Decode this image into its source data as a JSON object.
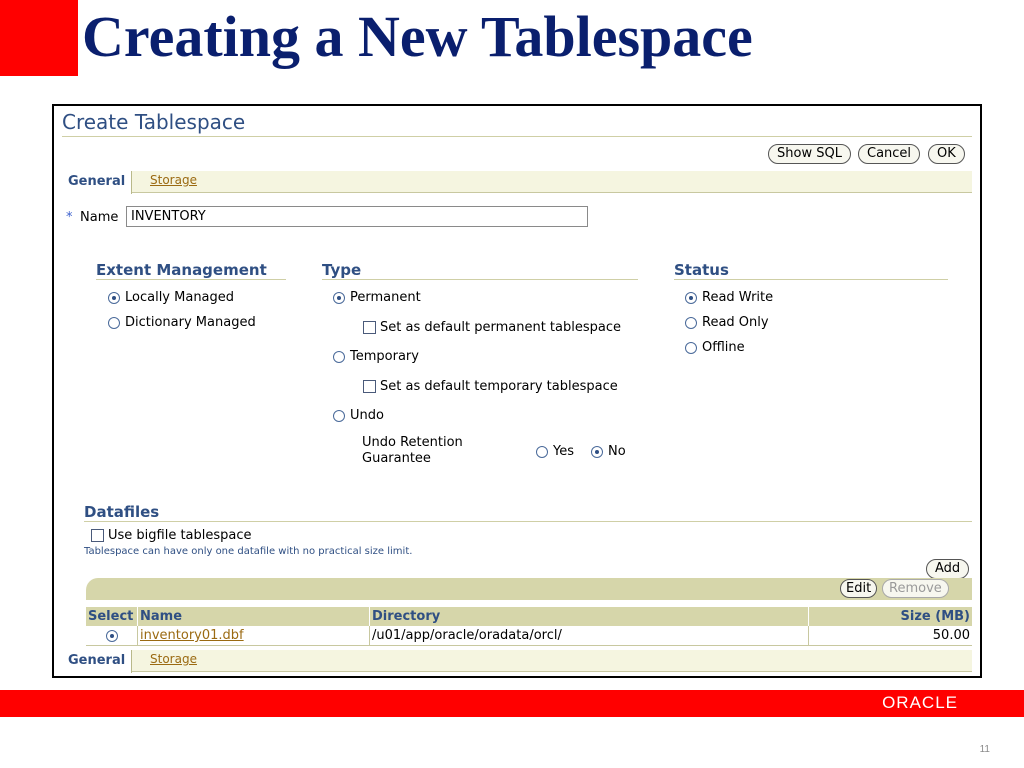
{
  "slide": {
    "title": "Creating a New Tablespace",
    "logo": "ORACLE",
    "page_number": "11"
  },
  "page_heading": "Create Tablespace",
  "buttons": {
    "show_sql": "Show SQL",
    "cancel": "Cancel",
    "ok": "OK",
    "add": "Add",
    "edit": "Edit",
    "remove": "Remove"
  },
  "tabs": {
    "general": "General",
    "storage": "Storage"
  },
  "name_field": {
    "required_mark": "*",
    "label": "Name",
    "value": "INVENTORY"
  },
  "extent_management": {
    "heading": "Extent Management",
    "options": [
      "Locally Managed",
      "Dictionary Managed"
    ],
    "selected": "Locally Managed"
  },
  "type": {
    "heading": "Type",
    "permanent": "Permanent",
    "default_permanent": "Set as default permanent tablespace",
    "temporary": "Temporary",
    "default_temporary": "Set as default temporary tablespace",
    "undo": "Undo",
    "undo_retention_line1": "Undo Retention",
    "undo_retention_line2": "Guarantee",
    "yes": "Yes",
    "no": "No",
    "selected": "Permanent",
    "undo_retention_selected": "No"
  },
  "status": {
    "heading": "Status",
    "options": [
      "Read Write",
      "Read Only",
      "Offline"
    ],
    "selected": "Read Write"
  },
  "datafiles": {
    "heading": "Datafiles",
    "bigfile_label": "Use bigfile tablespace",
    "bigfile_hint": "Tablespace can have only one datafile with no practical size limit.",
    "columns": [
      "Select",
      "Name",
      "Directory",
      "Size (MB)"
    ],
    "rows": [
      {
        "name": "inventory01.dbf",
        "directory": "/u01/app/oracle/oradata/orcl/",
        "size": "50.00"
      }
    ]
  },
  "colors": {
    "slide_red": "#ff0000",
    "title_navy": "#0a1f6e",
    "heading_blue": "#2f4f83",
    "link_brown": "#9b6a12",
    "table_header": "#d6d6aa"
  }
}
